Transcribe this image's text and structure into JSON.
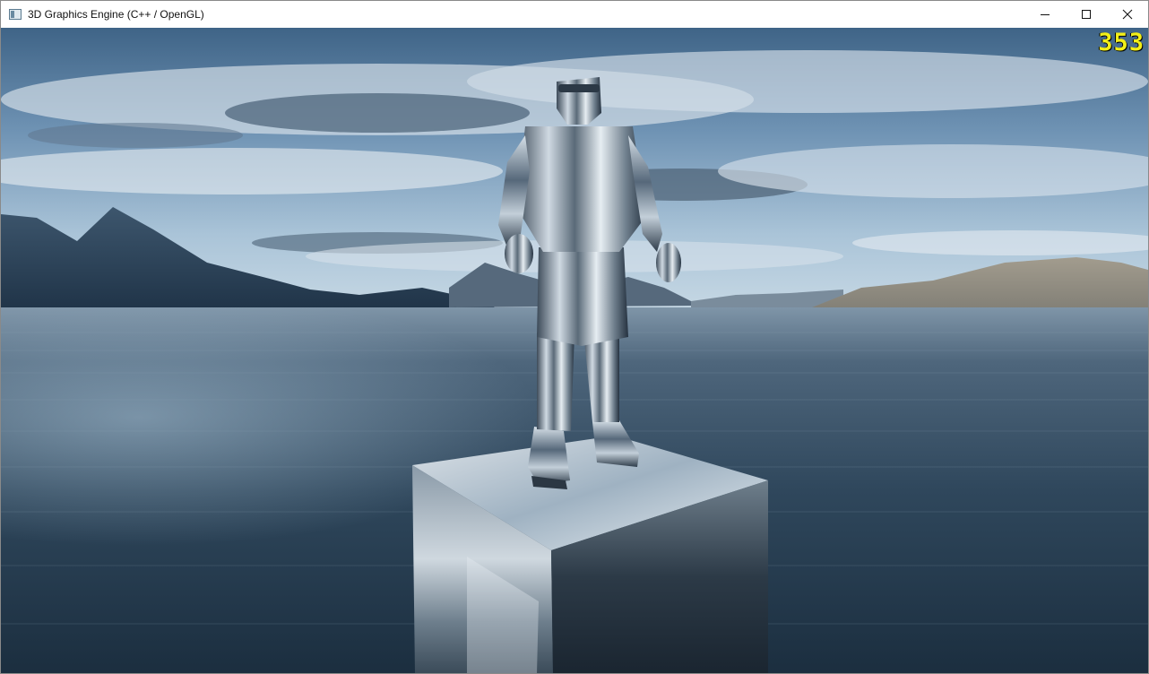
{
  "window": {
    "title": "3D Graphics Engine (C++ / OpenGL)",
    "controls": {
      "minimize": "minimize",
      "maximize": "maximize",
      "close": "close"
    }
  },
  "scene": {
    "fps_counter": "353",
    "fps_color": "#f2ef18",
    "objects": [
      "sky",
      "mountains",
      "ocean",
      "chrome-cube-pedestal",
      "chrome-armored-soldier"
    ]
  }
}
